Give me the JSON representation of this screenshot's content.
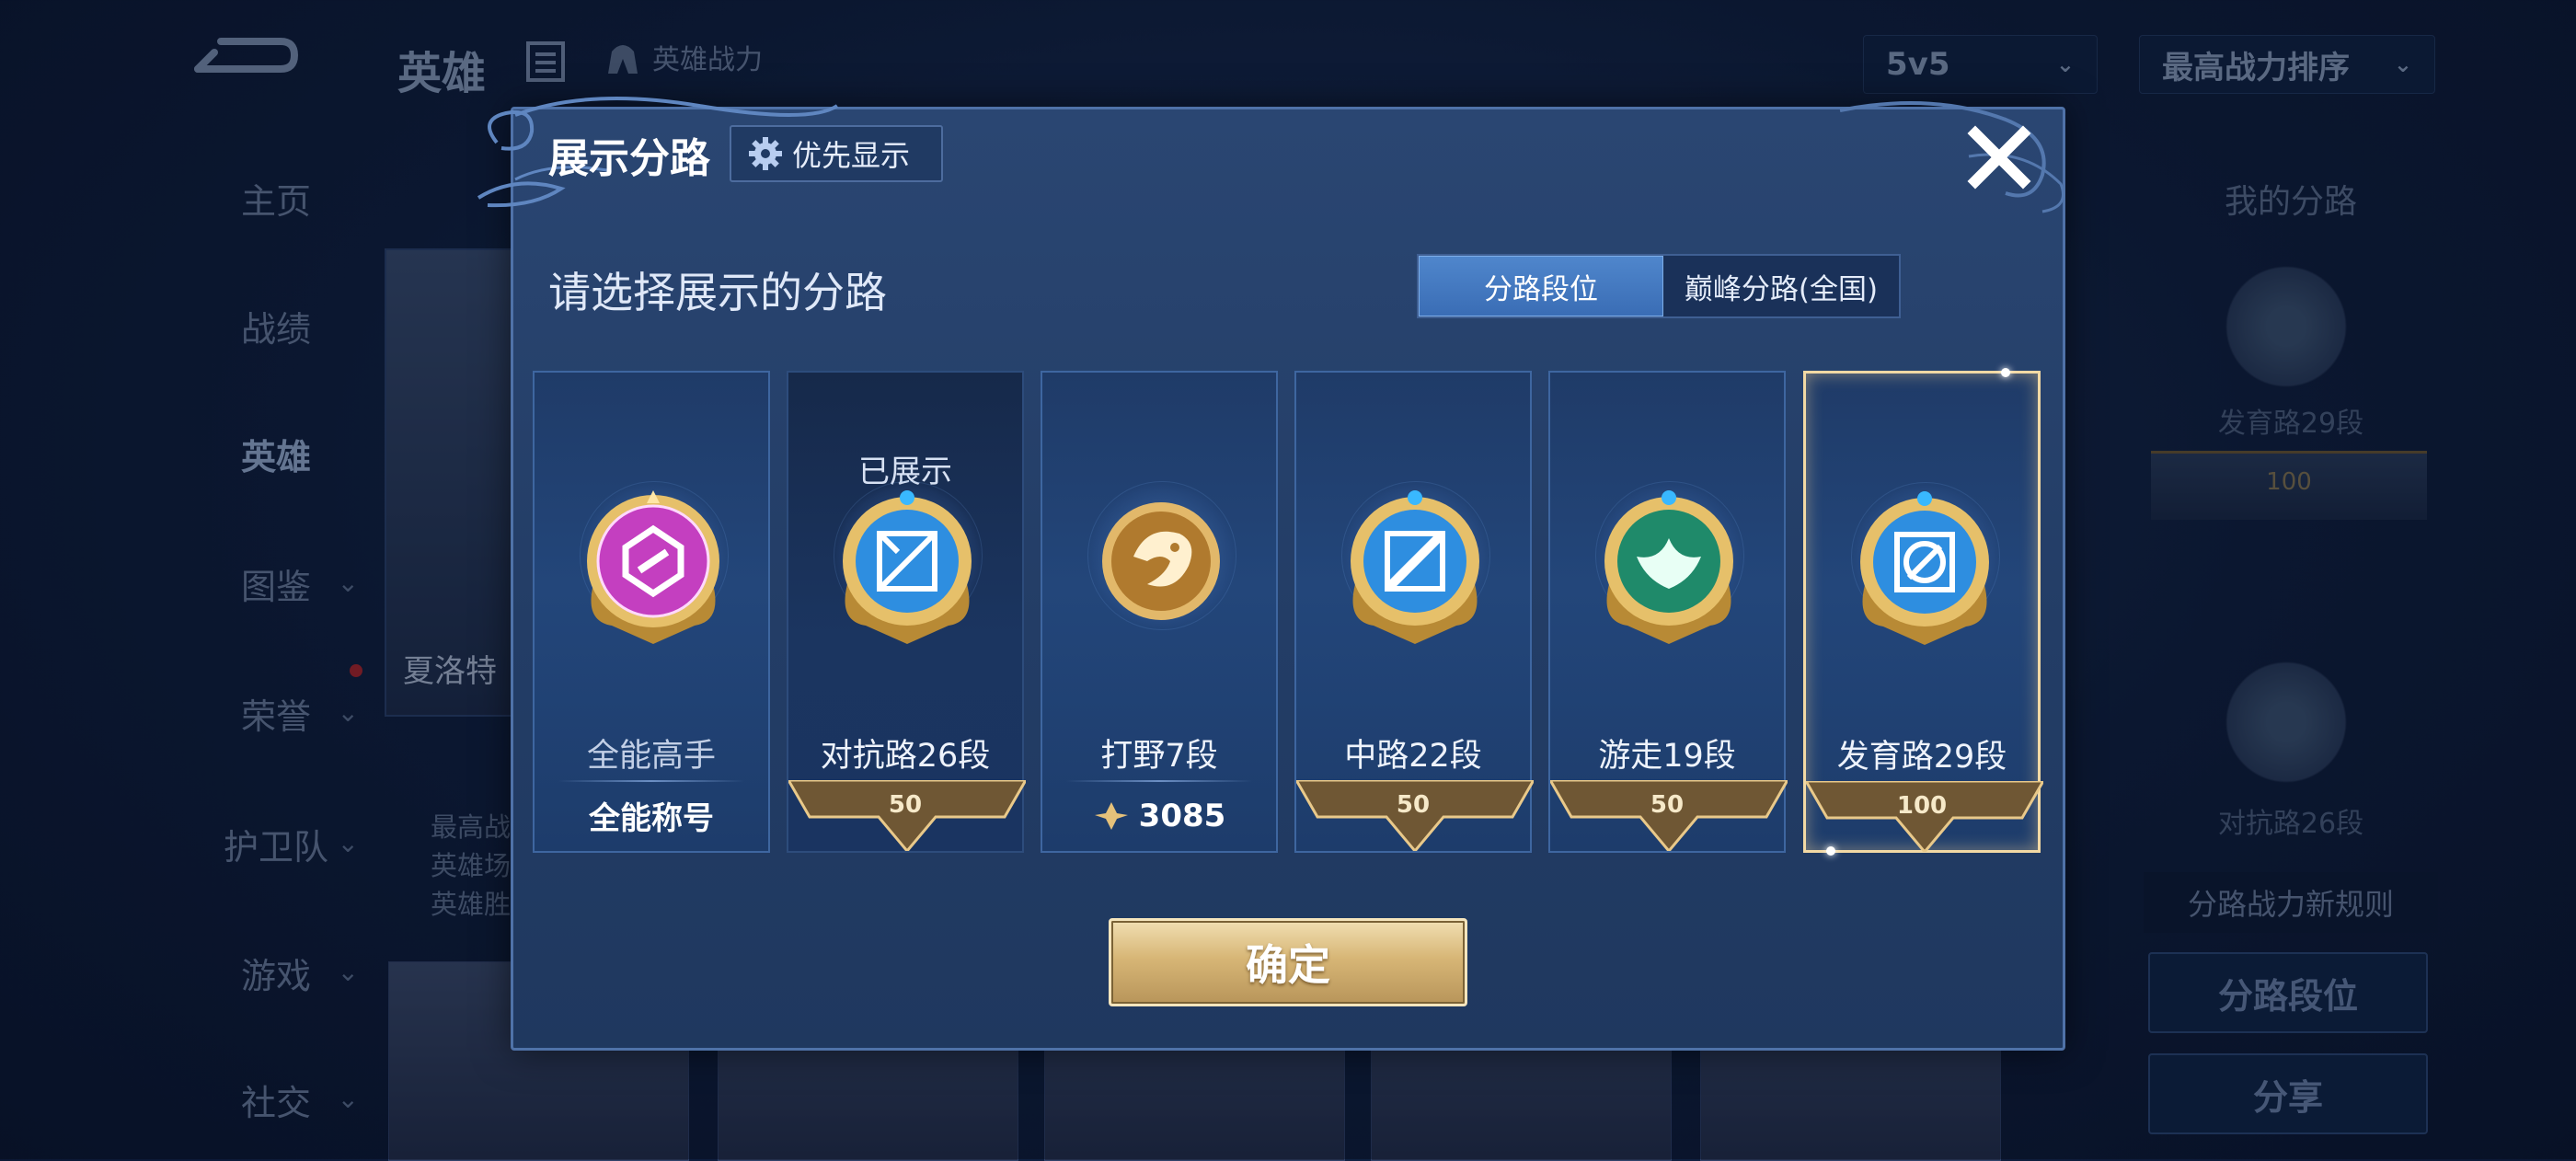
{
  "background": {
    "page_title": "英雄",
    "hero_power_label": "英雄战力",
    "mode_select": "5v5",
    "sort_select": "最高战力排序",
    "nav": [
      "主页",
      "战绩",
      "英雄",
      "图鉴",
      "荣誉",
      "护卫队",
      "游戏",
      "社交"
    ],
    "active_nav": "英雄",
    "hero_name_partial": "夏洛特",
    "hero_info_lines": [
      "最高战",
      "英雄场",
      "英雄胜"
    ],
    "my_lanes_title": "我的分路",
    "my_lane_1": "发育路29段",
    "my_lane_1_badge": "100",
    "my_lane_2": "对抗路26段",
    "lane_power_tip": "分路战力新规则",
    "lane_rank_button": "分路段位",
    "share_button": "分享"
  },
  "modal": {
    "title": "展示分路",
    "priority_button": "优先显示",
    "subtitle": "请选择展示的分路",
    "tabs": [
      {
        "label": "分路段位",
        "active": true
      },
      {
        "label": "巅峰分路(全国)",
        "active": false
      }
    ],
    "lanes": [
      {
        "name": "全能高手",
        "footer": "全能称号",
        "status": "",
        "medal_color": "#c43fc0",
        "icon": "allround-icon"
      },
      {
        "name": "对抗路26段",
        "badge": "50",
        "status": "已展示",
        "medal_color": "#2e8ee0",
        "icon": "clash-lane-icon"
      },
      {
        "name": "打野7段",
        "footer": "3085",
        "status": "",
        "medal_color": "#b07a2e",
        "icon": "jungle-icon"
      },
      {
        "name": "中路22段",
        "badge": "50",
        "status": "",
        "medal_color": "#2e8ee0",
        "icon": "mid-lane-icon"
      },
      {
        "name": "游走19段",
        "badge": "50",
        "status": "",
        "medal_color": "#1f8a6a",
        "icon": "roam-icon"
      },
      {
        "name": "发育路29段",
        "badge": "100",
        "status": "",
        "medal_color": "#2e8ee0",
        "icon": "farm-lane-icon",
        "selected": true
      }
    ],
    "confirm_button": "确定"
  }
}
